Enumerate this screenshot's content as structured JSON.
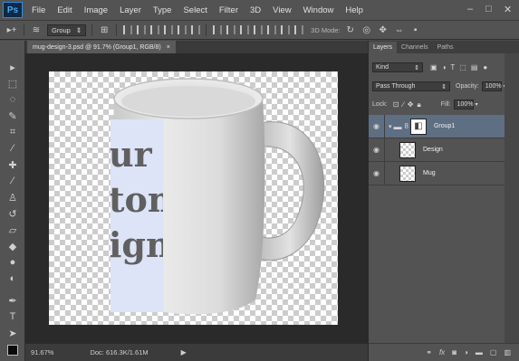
{
  "app": {
    "logo": "Ps"
  },
  "menu": [
    "File",
    "Edit",
    "Image",
    "Layer",
    "Type",
    "Select",
    "Filter",
    "3D",
    "View",
    "Window",
    "Help"
  ],
  "window_controls": {
    "minimize": "–",
    "maximize": "□",
    "close": "✕"
  },
  "options_bar": {
    "auto_select_value": "Group",
    "mode_label": "3D Mode:"
  },
  "document": {
    "tab_title": "mug-design-3.psd @ 91.7% (Group1, RGB/8)",
    "close": "×",
    "design_text": [
      "ur",
      "tom",
      "ign"
    ]
  },
  "status": {
    "zoom": "91.67%",
    "doc_info": "Doc: 616.3K/1.61M"
  },
  "panel": {
    "tabs": [
      "Layers",
      "Channels",
      "Paths"
    ],
    "active_tab": "Layers",
    "filter_kind": "Kind",
    "blend_mode": "Pass Through",
    "opacity_label": "Opacity:",
    "opacity_value": "100%",
    "lock_label": "Lock:",
    "fill_label": "Fill:",
    "fill_value": "100%",
    "layers": [
      {
        "name": "Group1",
        "type": "group",
        "selected": true
      },
      {
        "name": "Design",
        "type": "smart",
        "selected": false
      },
      {
        "name": "Mug",
        "type": "smart",
        "selected": false
      }
    ],
    "bottom_icons": [
      "link-icon",
      "fx-icon",
      "mask-icon",
      "adjustment-icon",
      "folder-icon",
      "new-layer-icon",
      "trash-icon"
    ]
  },
  "colors": {
    "ui_bg": "#535353",
    "canvas_bg": "#2a2a2a",
    "selected_layer": "#5e6e83",
    "design_label": "#dde4f7",
    "design_text": "#606060"
  }
}
